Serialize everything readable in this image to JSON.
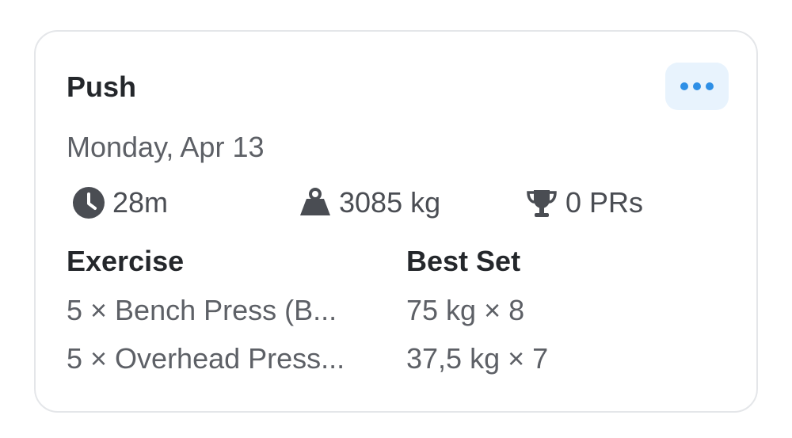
{
  "workout": {
    "title": "Push",
    "date": "Monday, Apr 13"
  },
  "menu": {
    "icon": "more-horizontal-icon",
    "accent_color": "#2e8fe6"
  },
  "stats": {
    "duration": {
      "icon": "clock-icon",
      "value": "28m"
    },
    "volume": {
      "icon": "weight-icon",
      "value": "3085 kg"
    },
    "prs": {
      "icon": "trophy-icon",
      "value": "0 PRs"
    }
  },
  "table": {
    "headers": {
      "exercise": "Exercise",
      "best_set": "Best Set"
    },
    "rows": [
      {
        "exercise": "5 × Bench Press (B...",
        "best_set": "75 kg × 8"
      },
      {
        "exercise": "5 × Overhead Press...",
        "best_set": "37,5 kg × 7"
      }
    ]
  }
}
